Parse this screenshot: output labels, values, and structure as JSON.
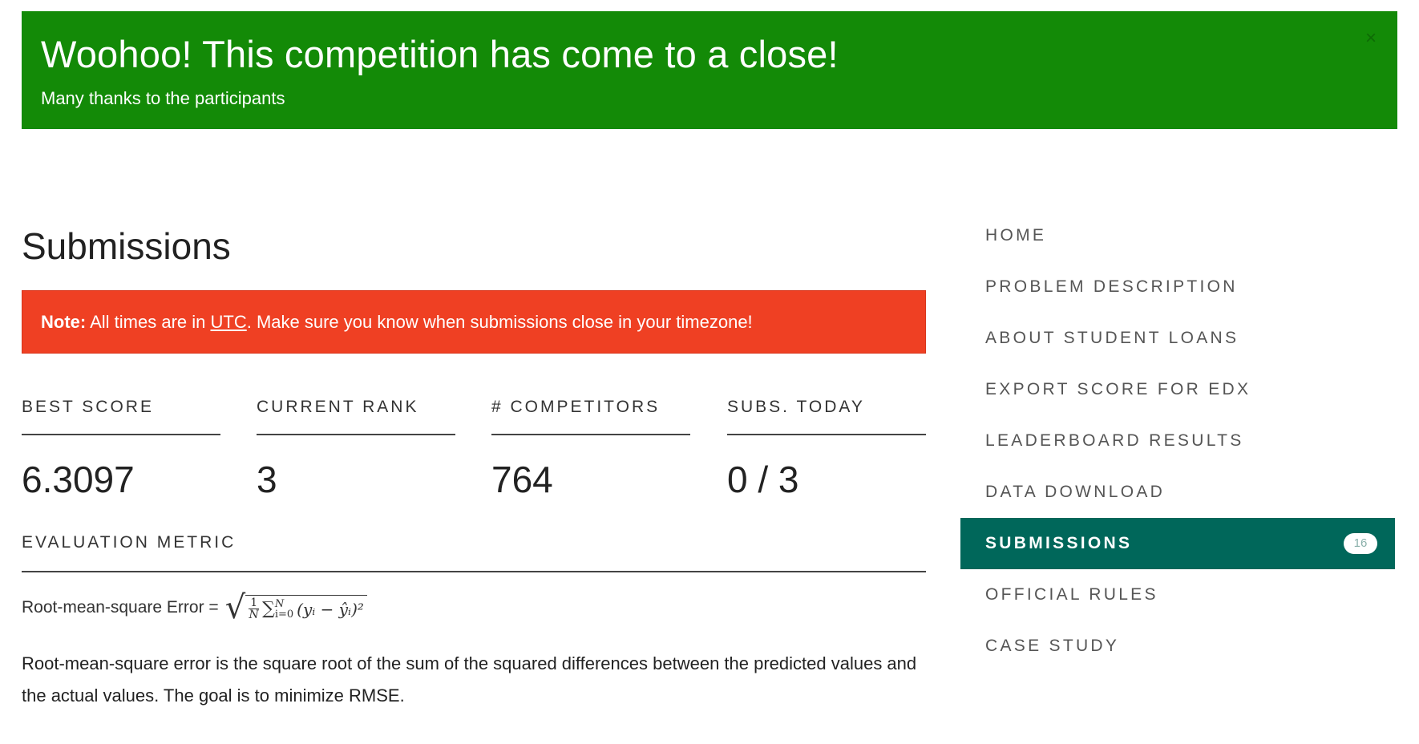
{
  "banner": {
    "title": "Woohoo! This competition has come to a close!",
    "subtitle": "Many thanks to the participants",
    "close_symbol": "×"
  },
  "main": {
    "title": "Submissions",
    "note": {
      "label": "Note:",
      "text_before": " All times are in ",
      "link": "UTC",
      "text_after": ". Make sure you know when submissions close in your timezone!"
    },
    "stats": [
      {
        "label": "BEST SCORE",
        "value": "6.3097"
      },
      {
        "label": "CURRENT RANK",
        "value": "3"
      },
      {
        "label": "# COMPETITORS",
        "value": "764"
      },
      {
        "label": "SUBS. TODAY",
        "value": "0 / 3"
      }
    ],
    "metric": {
      "label": "EVALUATION METRIC",
      "formula_prefix": "Root-mean-square Error =",
      "formula_frac_num": "1",
      "formula_frac_den": "N",
      "formula_sum": "∑",
      "formula_sum_upper": "N",
      "formula_sum_lower": "i=0",
      "formula_body": "(yᵢ − ŷᵢ)²",
      "description": "Root-mean-square error is the square root of the sum of the squared differences between the predicted values and the actual values. The goal is to minimize RMSE."
    }
  },
  "sidebar": {
    "items": [
      {
        "label": "HOME"
      },
      {
        "label": "PROBLEM DESCRIPTION"
      },
      {
        "label": "ABOUT STUDENT LOANS"
      },
      {
        "label": "EXPORT SCORE FOR EDX"
      },
      {
        "label": "LEADERBOARD RESULTS"
      },
      {
        "label": "DATA DOWNLOAD"
      },
      {
        "label": "SUBMISSIONS",
        "active": true,
        "badge": "16"
      },
      {
        "label": "OFFICIAL RULES"
      },
      {
        "label": "CASE STUDY"
      }
    ]
  },
  "colors": {
    "banner": "#138a07",
    "note": "#ef4023",
    "active_nav": "#00675a"
  }
}
